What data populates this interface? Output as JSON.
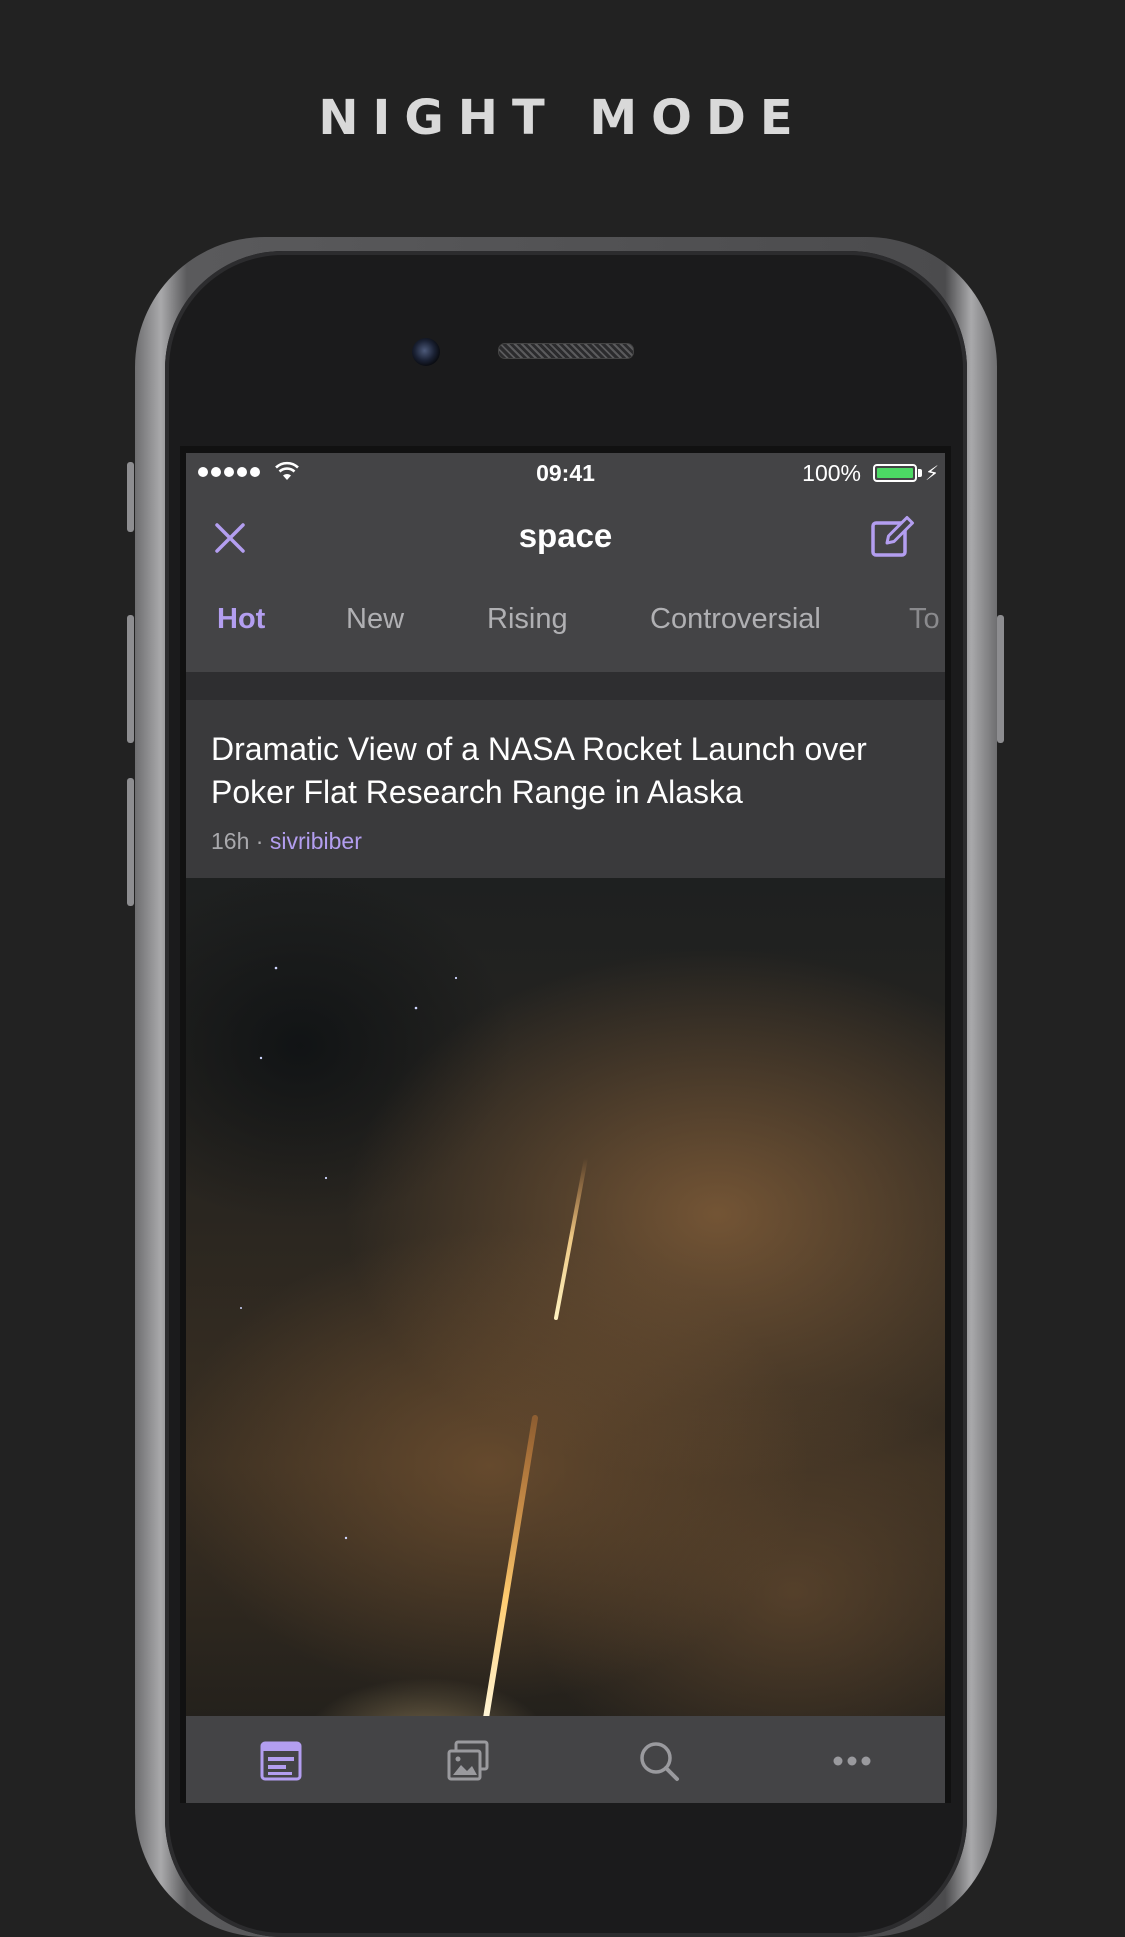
{
  "headline": "NIGHT MODE",
  "status_bar": {
    "time": "09:41",
    "battery": "100%"
  },
  "nav": {
    "title": "space"
  },
  "tabs": [
    {
      "label": "Hot"
    },
    {
      "label": "New"
    },
    {
      "label": "Rising"
    },
    {
      "label": "Controversial"
    },
    {
      "label": "To"
    }
  ],
  "post": {
    "title": "Dramatic View of a NASA Rocket Launch over Poker Flat Research Range in Alaska",
    "age": "16h",
    "separator": "·",
    "author": "sivribiber"
  },
  "tab_bar": [
    {
      "icon": "posts-icon",
      "active": true
    },
    {
      "icon": "gallery-icon",
      "active": false
    },
    {
      "icon": "search-icon",
      "active": false
    },
    {
      "icon": "more-icon",
      "active": false
    }
  ],
  "colors": {
    "accent": "#b39ef0",
    "background": "#222222",
    "nav_bg": "#444446",
    "card_bg": "#3a3a3c"
  }
}
